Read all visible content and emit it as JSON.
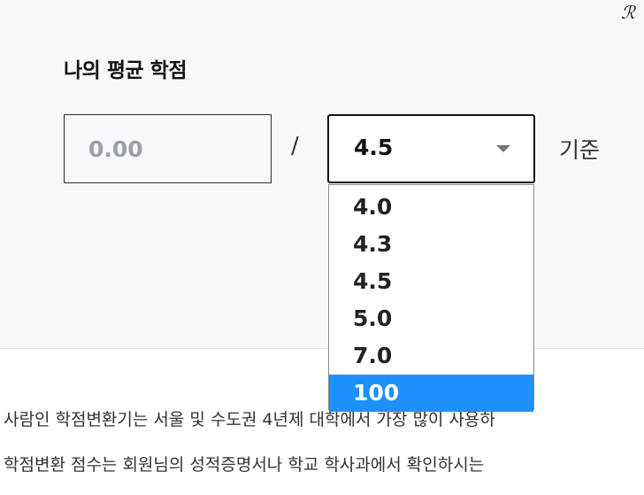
{
  "logo": {
    "text": "ℛ"
  },
  "gpa_section": {
    "title": "나의 평균 학점",
    "gpa_input": {
      "placeholder": "0.00",
      "value": ""
    },
    "separator": "/",
    "scale_select": {
      "selected": "4.5",
      "options": [
        "4.0",
        "4.3",
        "4.5",
        "5.0",
        "7.0",
        "100"
      ],
      "highlighted": "100",
      "open": true
    },
    "basis_label": "기준"
  },
  "description": {
    "line1": "사람인 학점변환기는 서울 및 수도권 4년제 대학에서 가장 많이 사용하",
    "line2": "학점변환 점수는 회원님의 성적증명서나 학교 학사과에서 확인하시는"
  },
  "colors": {
    "panel_background": "#f7f8fa",
    "highlight": "#1e90ff",
    "border": "#111111"
  },
  "icons": {
    "dropdown_caret": "chevron-down-icon"
  }
}
